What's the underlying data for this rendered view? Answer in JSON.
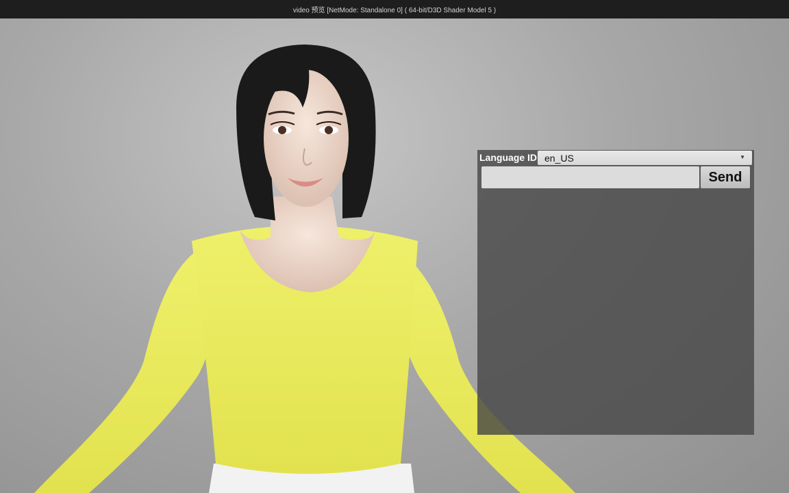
{
  "window": {
    "title": "video 预览 [NetMode: Standalone 0]   ( 64-bit/D3D Shader Model 5 )"
  },
  "chat_panel": {
    "language_label": "Language ID:",
    "language_selected": "en_US",
    "message_value": "",
    "message_placeholder": "",
    "send_label": "Send"
  },
  "colors": {
    "titlebar_bg": "#1e1e1e",
    "shirt": "#e9ea5a",
    "hair": "#1a1a1a",
    "skin": "#f0dcd0",
    "panel_bg": "rgba(72,72,72,0.82)"
  },
  "icons": {
    "dropdown": "chevron-down-icon"
  }
}
